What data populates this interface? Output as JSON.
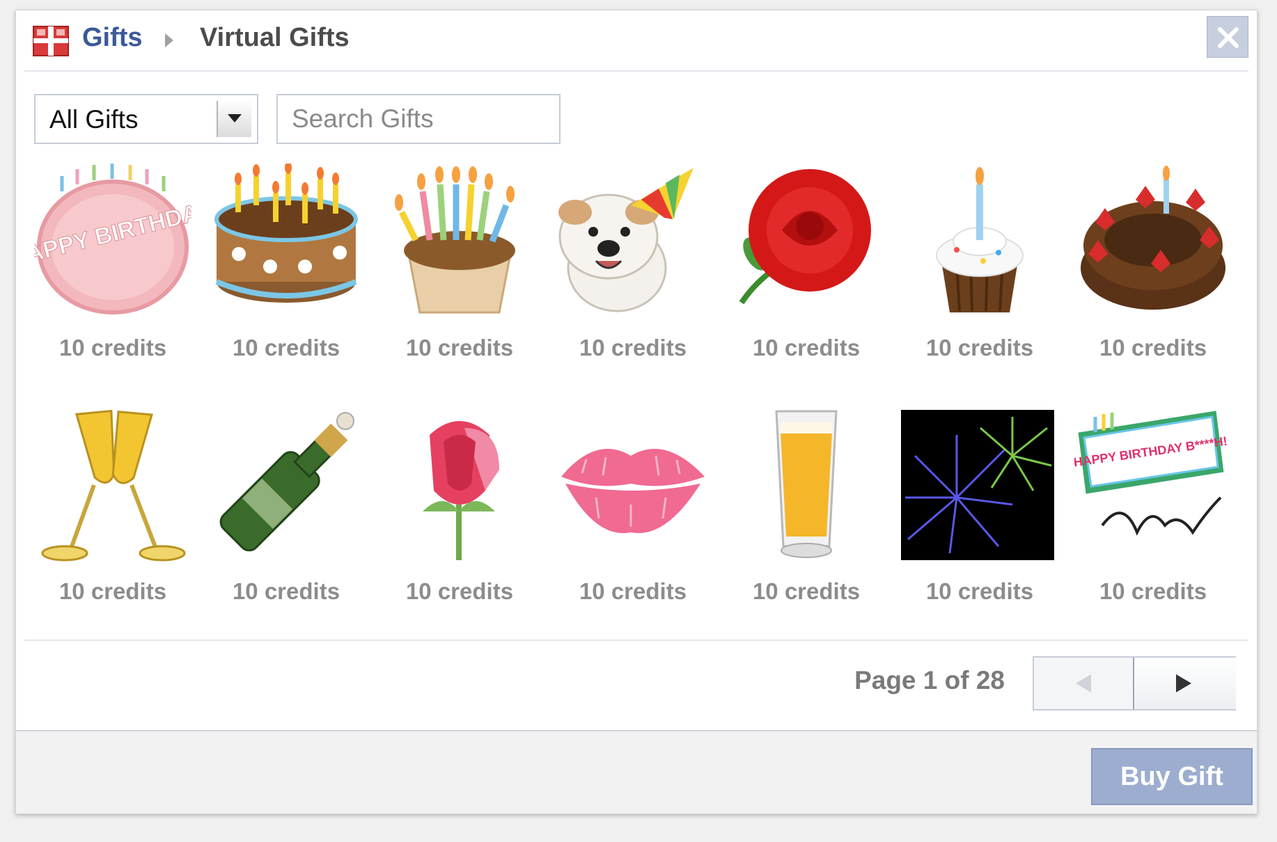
{
  "header": {
    "breadcrumb_root": "Gifts",
    "breadcrumb_current": "Virtual Gifts",
    "close_label": "✕"
  },
  "filters": {
    "category_selected": "All Gifts",
    "search_placeholder": "Search Gifts"
  },
  "gifts": [
    {
      "name": "happy-birthday-cake",
      "price": "10 credits",
      "label_text": "HAPPY BIRTHDAY"
    },
    {
      "name": "chocolate-candle-cake",
      "price": "10 credits"
    },
    {
      "name": "cupcake-many-candles",
      "price": "10 credits"
    },
    {
      "name": "party-bulldog",
      "price": "10 credits"
    },
    {
      "name": "red-rose",
      "price": "10 credits"
    },
    {
      "name": "cupcake-single-candle",
      "price": "10 credits"
    },
    {
      "name": "strawberry-chocolate-cake",
      "price": "10 credits"
    },
    {
      "name": "champagne-glasses",
      "price": "10 credits"
    },
    {
      "name": "champagne-bottle",
      "price": "10 credits"
    },
    {
      "name": "rosebud",
      "price": "10 credits"
    },
    {
      "name": "lipstick-kiss",
      "price": "10 credits"
    },
    {
      "name": "beer-glass",
      "price": "10 credits"
    },
    {
      "name": "fireworks",
      "price": "10 credits"
    },
    {
      "name": "birthday-sign-autograph",
      "price": "10 credits",
      "label_text": "HAPPY BIRTHDAY B****H!"
    }
  ],
  "pagination": {
    "label": "Page 1 of 28",
    "current_page": 1,
    "total_pages": 28
  },
  "actions": {
    "buy_label": "Buy Gift"
  },
  "colors": {
    "link_blue": "#3b5998",
    "button_disabled": "#9cadcf"
  }
}
